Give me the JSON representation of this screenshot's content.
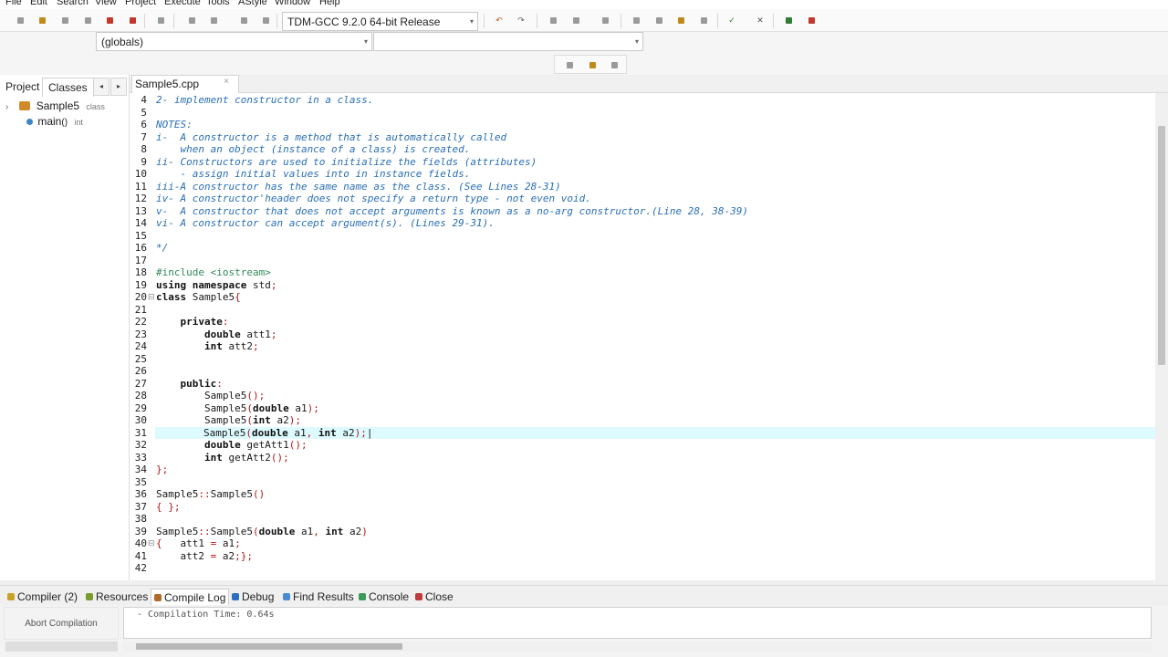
{
  "menu": [
    "File",
    "Edit",
    "Search",
    "View",
    "Project",
    "Execute",
    "Tools",
    "AStyle",
    "Window",
    "Help"
  ],
  "toolbar": {
    "compiler_select": "TDM-GCC 9.2.0 64-bit Release",
    "scope_select": "(globals)",
    "member_select": ""
  },
  "project_panel": {
    "tabs": [
      "Project",
      "Classes"
    ],
    "tree": [
      {
        "name": "Sample5",
        "type": "class"
      },
      {
        "name": "main",
        "suffix": "()",
        "type": "int"
      }
    ]
  },
  "editor": {
    "file_tab": "Sample5.cpp",
    "file_tab_close": "×",
    "current_line": 31,
    "lines": [
      {
        "n": "4",
        "fold": "",
        "segs": [
          {
            "t": "2- implement constructor in a class.",
            "c": "cm"
          }
        ]
      },
      {
        "n": "5",
        "fold": "",
        "segs": []
      },
      {
        "n": "6",
        "fold": "",
        "segs": [
          {
            "t": "NOTES:",
            "c": "cm"
          }
        ]
      },
      {
        "n": "7",
        "fold": "",
        "segs": [
          {
            "t": "i-  A constructor is a method that is automatically called",
            "c": "cm"
          }
        ]
      },
      {
        "n": "8",
        "fold": "",
        "segs": [
          {
            "t": "    when an object (instance of a class) is created.",
            "c": "cm"
          }
        ]
      },
      {
        "n": "9",
        "fold": "",
        "segs": [
          {
            "t": "ii- Constructors are used to initialize the fields (attributes)",
            "c": "cm"
          }
        ]
      },
      {
        "n": "10",
        "fold": "",
        "segs": [
          {
            "t": "    - assign initial values into in instance fields.",
            "c": "cm"
          }
        ]
      },
      {
        "n": "11",
        "fold": "",
        "segs": [
          {
            "t": "iii-A constructor has the same name as the class. (See Lines 28-31)",
            "c": "cm"
          }
        ]
      },
      {
        "n": "12",
        "fold": "",
        "segs": [
          {
            "t": "iv- A constructor'header does not specify a return type - not even void.",
            "c": "cm"
          }
        ]
      },
      {
        "n": "13",
        "fold": "",
        "segs": [
          {
            "t": "v-  A constructor that does not accept arguments is known as a no-arg constructor.(Line 28, 38-39)",
            "c": "cm"
          }
        ]
      },
      {
        "n": "14",
        "fold": "",
        "segs": [
          {
            "t": "vi- A constructor can accept argument(s). (Lines 29-31).",
            "c": "cm"
          }
        ]
      },
      {
        "n": "15",
        "fold": "",
        "segs": []
      },
      {
        "n": "16",
        "fold": "",
        "segs": [
          {
            "t": "*/",
            "c": "cm"
          }
        ]
      },
      {
        "n": "17",
        "fold": "",
        "segs": []
      },
      {
        "n": "18",
        "fold": "",
        "segs": [
          {
            "t": "#include <iostream>",
            "c": "pp"
          }
        ]
      },
      {
        "n": "19",
        "fold": "",
        "segs": [
          {
            "t": "using namespace",
            "c": "kw"
          },
          {
            "t": " std",
            "c": ""
          },
          {
            "t": ";",
            "c": "sy"
          }
        ]
      },
      {
        "n": "20",
        "fold": "⊟",
        "segs": [
          {
            "t": "class",
            "c": "kw"
          },
          {
            "t": " Sample5",
            "c": ""
          },
          {
            "t": "{",
            "c": "sy"
          }
        ]
      },
      {
        "n": "21",
        "fold": "",
        "segs": []
      },
      {
        "n": "22",
        "fold": "",
        "segs": [
          {
            "t": "    private",
            "c": "kw"
          },
          {
            "t": ":",
            "c": "sy"
          }
        ]
      },
      {
        "n": "23",
        "fold": "",
        "segs": [
          {
            "t": "        double",
            "c": "kw"
          },
          {
            "t": " att1",
            "c": ""
          },
          {
            "t": ";",
            "c": "sy"
          }
        ]
      },
      {
        "n": "24",
        "fold": "",
        "segs": [
          {
            "t": "        int",
            "c": "kw"
          },
          {
            "t": " att2",
            "c": ""
          },
          {
            "t": ";",
            "c": "sy"
          }
        ]
      },
      {
        "n": "25",
        "fold": "",
        "segs": []
      },
      {
        "n": "26",
        "fold": "",
        "segs": []
      },
      {
        "n": "27",
        "fold": "",
        "segs": [
          {
            "t": "    public",
            "c": "kw"
          },
          {
            "t": ":",
            "c": "sy"
          }
        ]
      },
      {
        "n": "28",
        "fold": "",
        "segs": [
          {
            "t": "        Sample5",
            "c": ""
          },
          {
            "t": "();",
            "c": "sy"
          }
        ]
      },
      {
        "n": "29",
        "fold": "",
        "segs": [
          {
            "t": "        Sample5",
            "c": ""
          },
          {
            "t": "(",
            "c": "sy"
          },
          {
            "t": "double",
            "c": "kw"
          },
          {
            "t": " a1",
            "c": ""
          },
          {
            "t": ");",
            "c": "sy"
          }
        ]
      },
      {
        "n": "30",
        "fold": "",
        "segs": [
          {
            "t": "        Sample5",
            "c": ""
          },
          {
            "t": "(",
            "c": "sy"
          },
          {
            "t": "int",
            "c": "kw"
          },
          {
            "t": " a2",
            "c": ""
          },
          {
            "t": ");",
            "c": "sy"
          }
        ]
      },
      {
        "n": "31",
        "fold": "",
        "segs": [
          {
            "t": "        Sample5",
            "c": ""
          },
          {
            "t": "(",
            "c": "sy"
          },
          {
            "t": "double",
            "c": "kw"
          },
          {
            "t": " a1",
            "c": ""
          },
          {
            "t": ",",
            "c": "sy"
          },
          {
            "t": " int",
            "c": "kw"
          },
          {
            "t": " a2",
            "c": ""
          },
          {
            "t": ");",
            "c": "sy"
          },
          {
            "t": "|",
            "c": ""
          }
        ]
      },
      {
        "n": "32",
        "fold": "",
        "segs": [
          {
            "t": "        double",
            "c": "kw"
          },
          {
            "t": " getAtt1",
            "c": ""
          },
          {
            "t": "();",
            "c": "sy"
          }
        ]
      },
      {
        "n": "33",
        "fold": "",
        "segs": [
          {
            "t": "        int",
            "c": "kw"
          },
          {
            "t": " getAtt2",
            "c": ""
          },
          {
            "t": "();",
            "c": "sy"
          }
        ]
      },
      {
        "n": "34",
        "fold": "",
        "segs": [
          {
            "t": "};",
            "c": "sy"
          }
        ]
      },
      {
        "n": "35",
        "fold": "",
        "segs": []
      },
      {
        "n": "36",
        "fold": "",
        "segs": [
          {
            "t": "Sample5",
            "c": ""
          },
          {
            "t": "::",
            "c": "sy"
          },
          {
            "t": "Sample5",
            "c": ""
          },
          {
            "t": "()",
            "c": "sy"
          }
        ]
      },
      {
        "n": "37",
        "fold": "",
        "segs": [
          {
            "t": "{ };",
            "c": "sy"
          }
        ]
      },
      {
        "n": "38",
        "fold": "",
        "segs": []
      },
      {
        "n": "39",
        "fold": "",
        "segs": [
          {
            "t": "Sample5",
            "c": ""
          },
          {
            "t": "::",
            "c": "sy"
          },
          {
            "t": "Sample5",
            "c": ""
          },
          {
            "t": "(",
            "c": "sy"
          },
          {
            "t": "double",
            "c": "kw"
          },
          {
            "t": " a1",
            "c": ""
          },
          {
            "t": ",",
            "c": "sy"
          },
          {
            "t": " int",
            "c": "kw"
          },
          {
            "t": " a2",
            "c": ""
          },
          {
            "t": ")",
            "c": "sy"
          }
        ]
      },
      {
        "n": "40",
        "fold": "⊟",
        "segs": [
          {
            "t": "{",
            "c": "sy"
          },
          {
            "t": "   att1 ",
            "c": ""
          },
          {
            "t": "=",
            "c": "sy"
          },
          {
            "t": " a1",
            "c": ""
          },
          {
            "t": ";",
            "c": "sy"
          }
        ]
      },
      {
        "n": "41",
        "fold": "",
        "segs": [
          {
            "t": "    att2 ",
            "c": ""
          },
          {
            "t": "=",
            "c": "sy"
          },
          {
            "t": " a2",
            "c": ""
          },
          {
            "t": ";};",
            "c": "sy"
          }
        ]
      },
      {
        "n": "42",
        "fold": "",
        "segs": []
      }
    ]
  },
  "bottom": {
    "tabs": [
      {
        "label": "Compiler (2)",
        "color": "#c9a227"
      },
      {
        "label": "Resources",
        "color": "#7a9a2a"
      },
      {
        "label": "Compile Log",
        "color": "#b06a2a"
      },
      {
        "label": "Debug",
        "color": "#2b70c0"
      },
      {
        "label": "Find Results",
        "color": "#4a8ad0"
      },
      {
        "label": "Console",
        "color": "#3a9a5a"
      },
      {
        "label": "Close",
        "color": "#c03a3a"
      }
    ],
    "active_tab": "Compile Log",
    "abort_button": "Abort Compilation",
    "log_text": "- Compilation Time: 0.64s"
  }
}
